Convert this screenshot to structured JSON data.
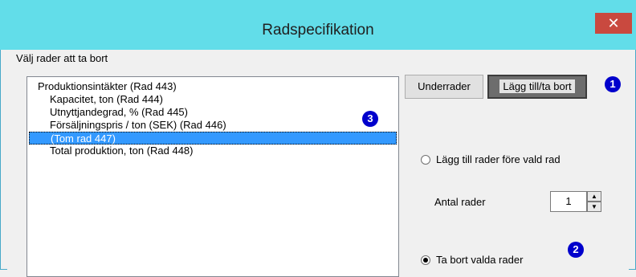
{
  "window": {
    "title": "Radspecifikation",
    "close_glyph": "✕"
  },
  "group": {
    "label": "Välj rader att ta bort"
  },
  "list": {
    "items": [
      {
        "label": "Produktionsintäkter (Rad 443)"
      },
      {
        "label": "Kapacitet, ton (Rad 444)"
      },
      {
        "label": "Utnyttjandegrad, % (Rad 445)"
      },
      {
        "label": "Försäljningspris / ton (SEK) (Rad 446)"
      },
      {
        "label": "(Tom rad 447)",
        "selected": true
      },
      {
        "label": "Total produktion, ton (Rad 448)"
      }
    ]
  },
  "buttons": {
    "subrows": "Underrader",
    "add_remove": "Lägg till/ta bort"
  },
  "badges": {
    "one": "1",
    "two": "2",
    "three": "3"
  },
  "options": {
    "add_before": "Lägg till rader före vald rad",
    "row_count_label": "Antal rader",
    "row_count_value": "1",
    "remove_selected": "Ta bort valda rader",
    "selected_option": "remove_selected"
  },
  "icons": {
    "spin_up": "▲",
    "spin_down": "▼"
  },
  "colors": {
    "titlebar": "#62dde9",
    "close_button": "#c9493f",
    "selection": "#3399ff",
    "badge": "#0000cc"
  }
}
